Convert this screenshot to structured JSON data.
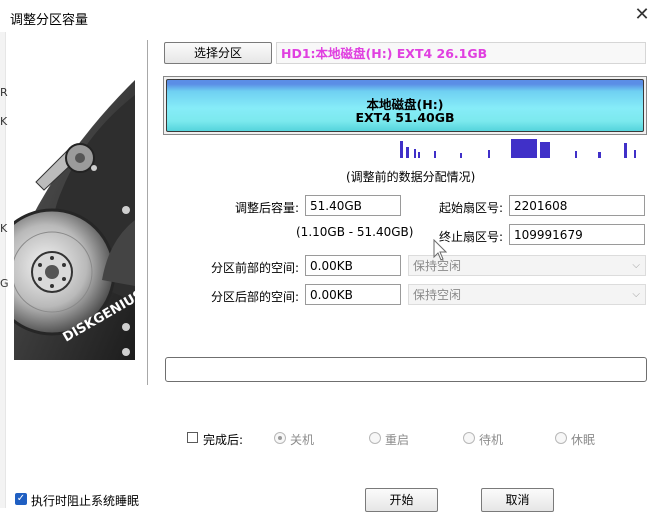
{
  "window": {
    "title": "调整分区容量",
    "close_glyph": "✕"
  },
  "side_fragments": [
    "R",
    "K",
    "K",
    "G"
  ],
  "art": {
    "brand": "DISKGENIUS"
  },
  "partition": {
    "select_button": "选择分区",
    "label": "HD1:本地磁盘(H:) EXT4 26.1GB",
    "label_color": "#e040e0"
  },
  "bar": {
    "line1": "本地磁盘(H:)",
    "line2": "EXT4 51.40GB"
  },
  "caption": "(调整前的数据分配情况)",
  "form": {
    "new_size_label": "调整后容量:",
    "new_size_value": "51.40GB",
    "range": "(1.10GB - 51.40GB)",
    "start_sector_label": "起始扇区号:",
    "start_sector_value": "2201608",
    "end_sector_label": "终止扇区号:",
    "end_sector_value": "109991679",
    "before_space_label": "分区前部的空间:",
    "before_space_value": "0.00KB",
    "before_space_option": "保持空闲",
    "after_space_label": "分区后部的空间:",
    "after_space_value": "0.00KB",
    "after_space_option": "保持空闲"
  },
  "after_done": {
    "label": "完成后:",
    "options": [
      "关机",
      "重启",
      "待机",
      "休眠"
    ],
    "selected": "关机"
  },
  "prevent_sleep": {
    "label": "执行时阻止系统睡眠",
    "checked": true
  },
  "buttons": {
    "start": "开始",
    "cancel": "取消"
  },
  "colors": {
    "bar_top": "#5b8ee6",
    "bar_fill": "#86ecf8",
    "map_marks": "#4030c8",
    "checkbox": "#1f5fc2"
  }
}
